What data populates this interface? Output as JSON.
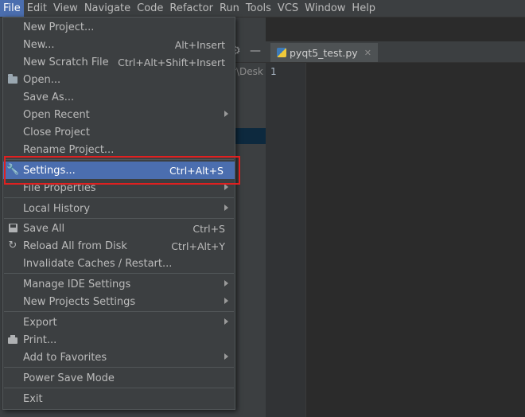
{
  "menubar": {
    "items": [
      "File",
      "Edit",
      "View",
      "Navigate",
      "Code",
      "Refactor",
      "Run",
      "Tools",
      "VCS",
      "Window",
      "Help"
    ]
  },
  "background": {
    "path_fragment": "r\\Desk",
    "editor_tab": "pyqt5_test.py",
    "line_number": "1"
  },
  "file_menu": {
    "items": [
      {
        "label": "New Project...",
        "shortcut": ""
      },
      {
        "label": "New...",
        "shortcut": "Alt+Insert"
      },
      {
        "label": "New Scratch File",
        "shortcut": "Ctrl+Alt+Shift+Insert"
      },
      {
        "label": "Open...",
        "shortcut": ""
      },
      {
        "label": "Save As...",
        "shortcut": ""
      },
      {
        "label": "Open Recent",
        "shortcut": ""
      },
      {
        "label": "Close Project",
        "shortcut": ""
      },
      {
        "label": "Rename Project...",
        "shortcut": ""
      },
      {
        "label": "Settings...",
        "shortcut": "Ctrl+Alt+S"
      },
      {
        "label": "File Properties",
        "shortcut": ""
      },
      {
        "label": "Local History",
        "shortcut": ""
      },
      {
        "label": "Save All",
        "shortcut": "Ctrl+S"
      },
      {
        "label": "Reload All from Disk",
        "shortcut": "Ctrl+Alt+Y"
      },
      {
        "label": "Invalidate Caches / Restart...",
        "shortcut": ""
      },
      {
        "label": "Manage IDE Settings",
        "shortcut": ""
      },
      {
        "label": "New Projects Settings",
        "shortcut": ""
      },
      {
        "label": "Export",
        "shortcut": ""
      },
      {
        "label": "Print...",
        "shortcut": ""
      },
      {
        "label": "Add to Favorites",
        "shortcut": ""
      },
      {
        "label": "Power Save Mode",
        "shortcut": ""
      },
      {
        "label": "Exit",
        "shortcut": ""
      }
    ]
  },
  "colors": {
    "selection": "#4b6eaf",
    "highlight_box": "#e02020"
  }
}
